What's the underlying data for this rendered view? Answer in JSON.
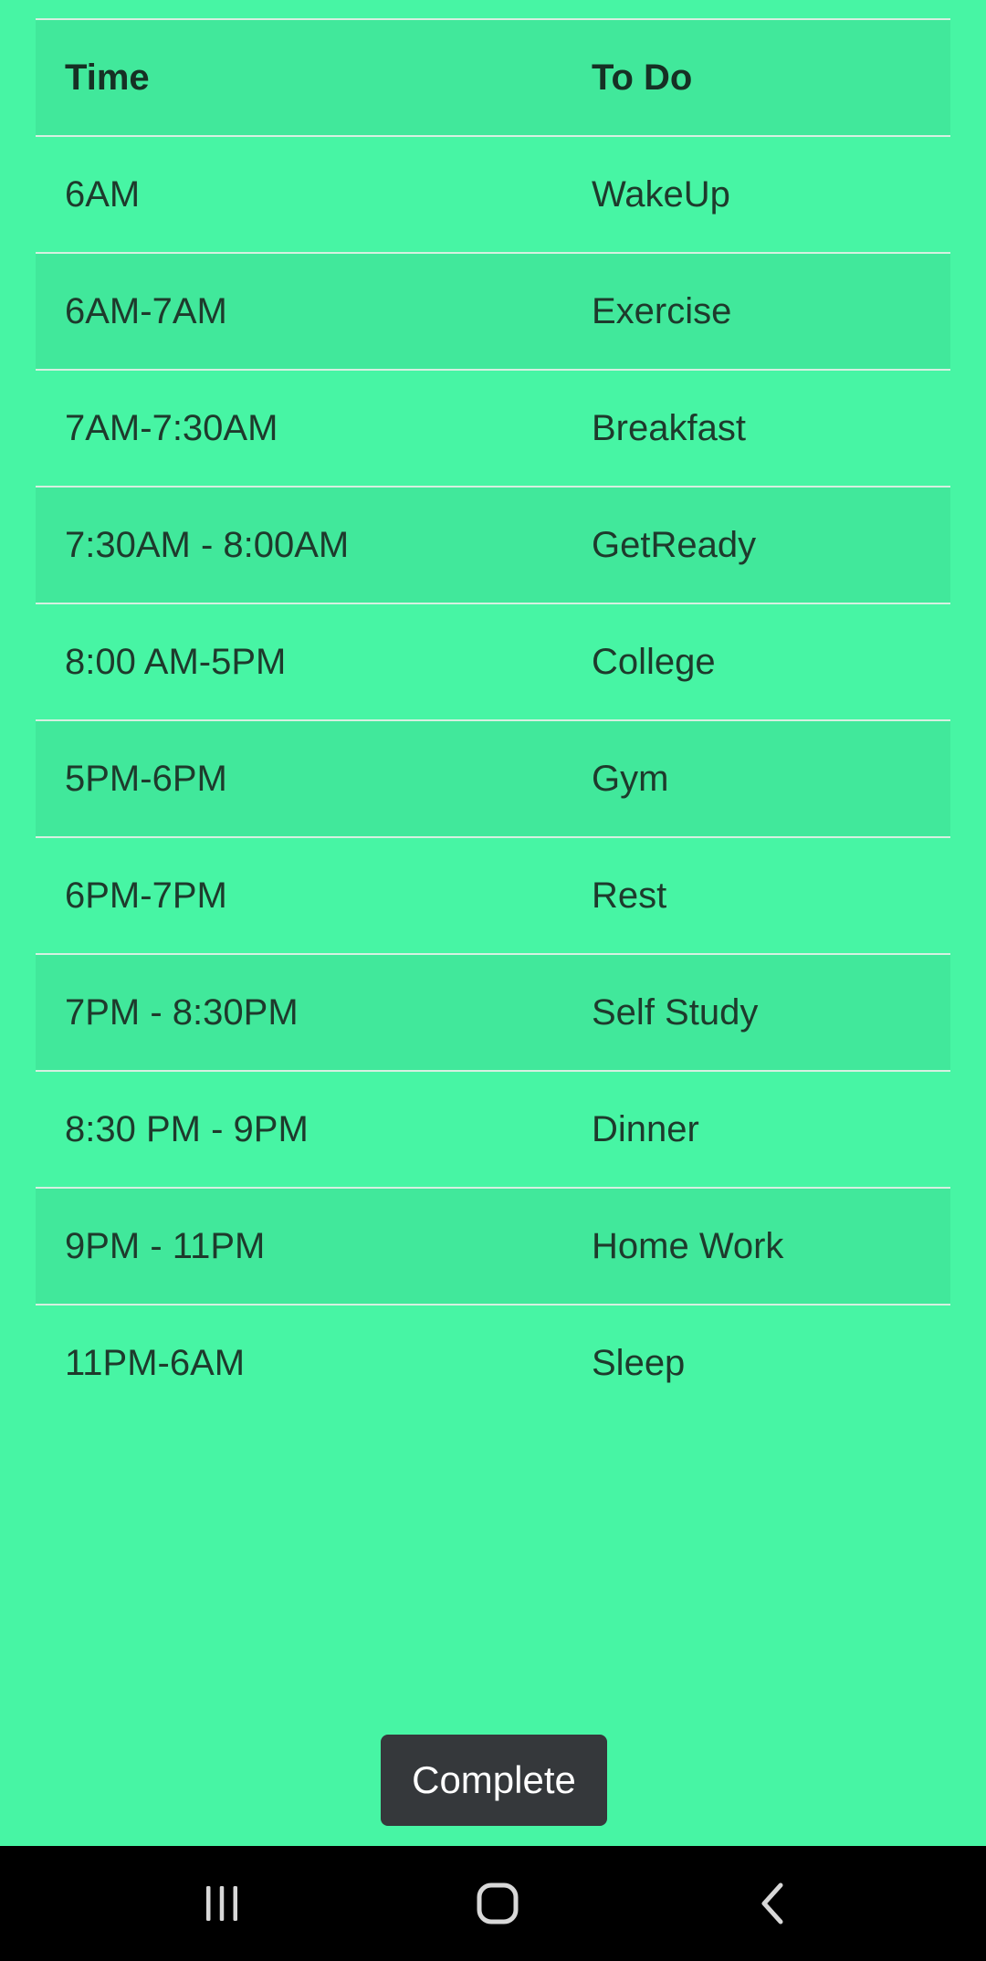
{
  "schedule": {
    "columns": [
      "Time",
      "To Do"
    ],
    "rows": [
      {
        "time": "6AM",
        "todo": "WakeUp"
      },
      {
        "time": "6AM-7AM",
        "todo": "Exercise"
      },
      {
        "time": "7AM-7:30AM",
        "todo": "Breakfast"
      },
      {
        "time": "7:30AM - 8:00AM",
        "todo": "GetReady"
      },
      {
        "time": "8:00 AM-5PM",
        "todo": "College"
      },
      {
        "time": "5PM-6PM",
        "todo": "Gym"
      },
      {
        "time": "6PM-7PM",
        "todo": "Rest"
      },
      {
        "time": "7PM - 8:30PM",
        "todo": "Self Study"
      },
      {
        "time": "8:30 PM - 9PM",
        "todo": "Dinner"
      },
      {
        "time": "9PM - 11PM",
        "todo": "Home Work"
      },
      {
        "time": "11PM-6AM",
        "todo": "Sleep"
      }
    ]
  },
  "toast": {
    "label": "Complete"
  },
  "navbar": {
    "icons": [
      "recent-apps-icon",
      "home-icon",
      "back-icon"
    ]
  },
  "colors": {
    "background": "#47f5a4",
    "row_alt": "#41e89b",
    "toast_bg": "#35383b",
    "navbar_bg": "#000000"
  }
}
